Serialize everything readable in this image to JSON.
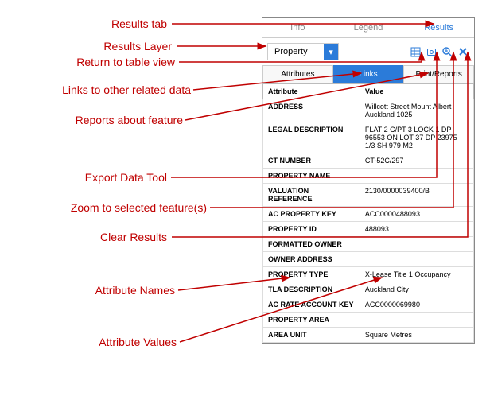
{
  "annotations": {
    "results_tab": "Results tab",
    "results_layer": "Results Layer",
    "return_table": "Return to table view",
    "links_related": "Links to other related data",
    "reports_feature": "Reports about feature",
    "export_tool": "Export Data Tool",
    "zoom_selected": "Zoom to selected feature(s)",
    "clear_results": "Clear Results",
    "attr_names": "Attribute Names",
    "attr_values": "Attribute Values"
  },
  "top_tabs": {
    "info": "Info",
    "legend": "Legend",
    "results": "Results"
  },
  "layer": {
    "selected": "Property"
  },
  "sub_tabs": {
    "attributes": "Attributes",
    "links": "Links",
    "reports": "Print/Reports"
  },
  "table": {
    "header_name": "Attribute",
    "header_value": "Value",
    "rows": [
      {
        "name": "ADDRESS",
        "value": "Willcott Street Mount Albert Auckland 1025"
      },
      {
        "name": "LEGAL DESCRIPTION",
        "value": "FLAT 2 C/PT 3 LOCK 1 DP 96553 ON LOT 37 DP 23975 1/3 SH 979 M2"
      },
      {
        "name": "CT NUMBER",
        "value": "CT-52C/297"
      },
      {
        "name": "PROPERTY NAME",
        "value": ""
      },
      {
        "name": "VALUATION REFERENCE",
        "value": "2130/0000039400/B"
      },
      {
        "name": "AC PROPERTY KEY",
        "value": "ACC0000488093"
      },
      {
        "name": "PROPERTY ID",
        "value": "488093"
      },
      {
        "name": "FORMATTED OWNER",
        "value": ""
      },
      {
        "name": "OWNER ADDRESS",
        "value": ""
      },
      {
        "name": "PROPERTY TYPE",
        "value": "X-Lease Title 1 Occupancy"
      },
      {
        "name": "TLA DESCRIPTION",
        "value": "Auckland City"
      },
      {
        "name": "AC RATE ACCOUNT KEY",
        "value": "ACC0000069980"
      },
      {
        "name": "PROPERTY AREA",
        "value": ""
      },
      {
        "name": "AREA UNIT",
        "value": "Square Metres"
      }
    ]
  }
}
